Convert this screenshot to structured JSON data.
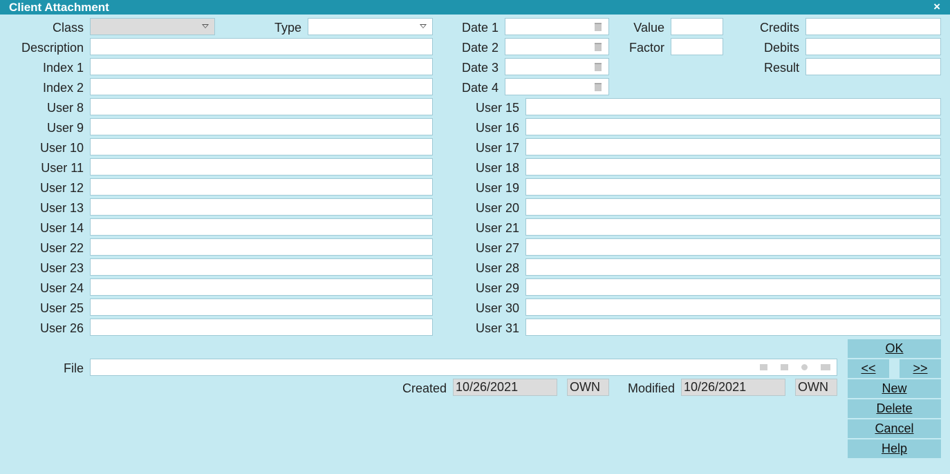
{
  "window": {
    "title": "Client Attachment",
    "close_glyph": "×"
  },
  "row1": {
    "class_label": "Class",
    "type_label": "Type",
    "date1_label": "Date 1",
    "value_label": "Value",
    "credits_label": "Credits"
  },
  "row2": {
    "description_label": "Description",
    "date2_label": "Date 2",
    "factor_label": "Factor",
    "debits_label": "Debits"
  },
  "row3": {
    "index1_label": "Index 1",
    "date3_label": "Date 3",
    "result_label": "Result"
  },
  "row4": {
    "index2_label": "Index 2",
    "date4_label": "Date 4"
  },
  "left_user_labels": [
    "User 8",
    "User 9",
    "User 10",
    "User 11",
    "User 12",
    "User 13",
    "User 14",
    "User 22",
    "User 23",
    "User 24",
    "User 25",
    "User 26"
  ],
  "right_user_labels": [
    "User 15",
    "User 16",
    "User 17",
    "User 18",
    "User 19",
    "User 20",
    "User 21",
    "User 27",
    "User 28",
    "User 29",
    "User 30",
    "User 31"
  ],
  "file": {
    "label": "File"
  },
  "audit": {
    "created_label": "Created",
    "created_date": "10/26/2021",
    "created_by": "OWN",
    "modified_label": "Modified",
    "modified_date": "10/26/2021",
    "modified_by": "OWN"
  },
  "buttons": {
    "ok": "OK",
    "prev": "<<",
    "next": ">>",
    "new": "New",
    "delete": "Delete",
    "cancel": "Cancel",
    "help": "Help"
  },
  "colors": {
    "titlebar": "#1f94ad",
    "background": "#c5eaf2",
    "button": "#93cfdc"
  }
}
